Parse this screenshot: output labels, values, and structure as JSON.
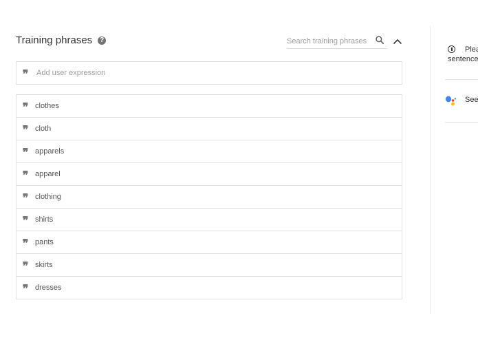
{
  "section": {
    "title": "Training phrases",
    "help_icon": "help-circle-icon"
  },
  "search": {
    "placeholder": "Search training phrases",
    "icon": "search-icon"
  },
  "collapse_icon": "chevron-up-icon",
  "add_expression": {
    "placeholder": "Add user expression",
    "icon": "quote-icon"
  },
  "phrases": [
    {
      "text": "clothes"
    },
    {
      "text": "cloth"
    },
    {
      "text": "apparels"
    },
    {
      "text": "apparel"
    },
    {
      "text": "clothing"
    },
    {
      "text": "shirts"
    },
    {
      "text": "pants"
    },
    {
      "text": "skirts"
    },
    {
      "text": "dresses"
    }
  ],
  "right_panel": {
    "info_line1": "Plea",
    "info_line2": "sentence.",
    "info_icon": "info-icon",
    "assistant_text": "See",
    "assistant_icon": "google-assistant-icon"
  },
  "colors": {
    "border": "#e0e0e0",
    "icon_gray": "#757575",
    "text": "#333333"
  }
}
